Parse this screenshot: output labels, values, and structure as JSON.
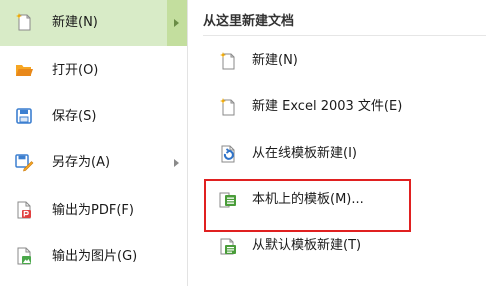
{
  "left_menu": {
    "items": [
      {
        "label": "新建(N)",
        "icon": "new-document-icon",
        "active": true,
        "has_submenu": true
      },
      {
        "label": "打开(O)",
        "icon": "folder-open-icon",
        "active": false,
        "has_submenu": false
      },
      {
        "label": "保存(S)",
        "icon": "save-icon",
        "active": false,
        "has_submenu": false
      },
      {
        "label": "另存为(A)",
        "icon": "save-as-icon",
        "active": false,
        "has_submenu": true
      },
      {
        "label": "输出为PDF(F)",
        "icon": "export-pdf-icon",
        "active": false,
        "has_submenu": false
      },
      {
        "label": "输出为图片(G)",
        "icon": "export-image-icon",
        "active": false,
        "has_submenu": false
      }
    ]
  },
  "submenu": {
    "title": "从这里新建文档",
    "items": [
      {
        "label": "新建(N)",
        "icon": "new-document-icon"
      },
      {
        "label": "新建 Excel 2003 文件(E)",
        "icon": "new-excel-icon"
      },
      {
        "label": "从在线模板新建(I)",
        "icon": "online-template-icon"
      },
      {
        "label": "本机上的模板(M)...",
        "icon": "local-template-icon",
        "highlighted": true
      },
      {
        "label": "从默认模板新建(T)",
        "icon": "default-template-icon"
      }
    ]
  },
  "colors": {
    "active_bg": "#d8ebc7",
    "active_arrow_bg": "#c3de9e",
    "highlight_border": "#e02020",
    "accent_green": "#5a9e2e"
  }
}
